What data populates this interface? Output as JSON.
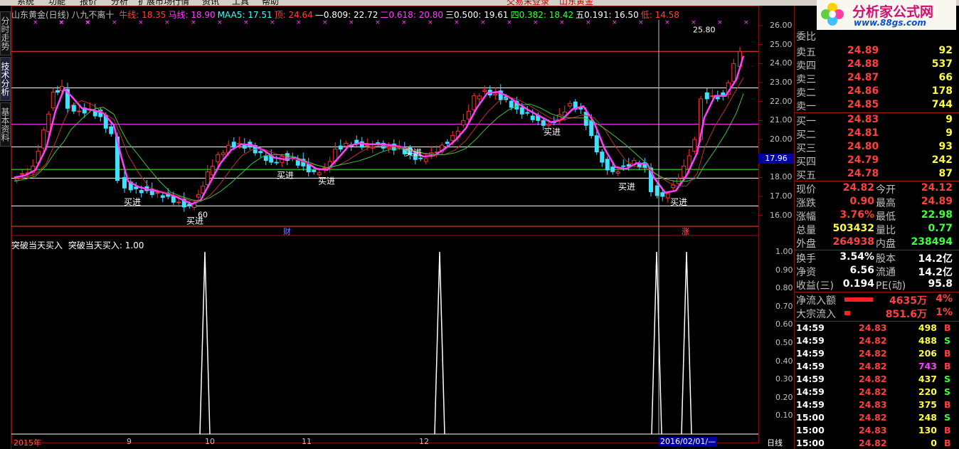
{
  "menu": [
    "系统",
    "功能",
    "报价",
    "分析",
    "扩展市场行情",
    "资讯",
    "工具",
    "帮助"
  ],
  "menu_right": [
    "交易未登录",
    "山东黄金"
  ],
  "side_tabs": [
    "分时走势",
    "技术分析",
    "基本资料"
  ],
  "header": {
    "stock": "山东黄金(日线)",
    "indicator": "八九不离十",
    "items": [
      {
        "label": "牛线: 18.35",
        "color": "#ff4040"
      },
      {
        "label": "马线: 18.90",
        "color": "#ff40ff"
      },
      {
        "label": "MAA5: 17.51",
        "color": "#40ffff"
      },
      {
        "label": "顶: 24.64",
        "color": "#ff4040"
      },
      {
        "label": "—0.809: 22.72",
        "color": "#ffffff"
      },
      {
        "label": "二0.618: 20.80",
        "color": "#ff40ff"
      },
      {
        "label": "三0.500: 19.61",
        "color": "#ffffff"
      },
      {
        "label": "四0.382: 18.42",
        "color": "#40ff40"
      },
      {
        "label": "五0.191: 16.50",
        "color": "#ffffff"
      },
      {
        "label": "低: 14.58",
        "color": "#ff4040"
      }
    ]
  },
  "price_axis": [
    "26.00",
    "25.00",
    "24.00",
    "23.00",
    "22.00",
    "21.00",
    "20.00",
    "19.00",
    "18.00",
    "17.00",
    "16.00"
  ],
  "current_price_tag": "17.96",
  "annotations": {
    "peak": "25.80",
    "low": "60",
    "buy": "买进",
    "fin": "财",
    "rise": "涨"
  },
  "sub_indicator": {
    "title": "突破当天买入",
    "value_label": "突破当天买入: 1.00"
  },
  "sub_axis": [
    "1.00",
    "0.90",
    "0.80",
    "0.70",
    "0.60",
    "0.50",
    "0.40",
    "0.30",
    "0.20",
    "0.10"
  ],
  "date_axis": [
    "2015年",
    "9",
    "10",
    "11",
    "12",
    "2016/02/01/—"
  ],
  "period_label": "日线",
  "logo": {
    "title": "分析家公式网",
    "url": "www.88gs.com"
  },
  "order_book": {
    "ratio_label": "委比",
    "asks": [
      {
        "label": "卖五",
        "price": "24.89",
        "vol": "92"
      },
      {
        "label": "卖四",
        "price": "24.88",
        "vol": "537"
      },
      {
        "label": "卖三",
        "price": "24.87",
        "vol": "66"
      },
      {
        "label": "卖二",
        "price": "24.86",
        "vol": "178"
      },
      {
        "label": "卖一",
        "price": "24.85",
        "vol": "744"
      }
    ],
    "bids": [
      {
        "label": "买一",
        "price": "24.83",
        "vol": "9"
      },
      {
        "label": "买二",
        "price": "24.81",
        "vol": "9"
      },
      {
        "label": "买三",
        "price": "24.80",
        "vol": "93"
      },
      {
        "label": "买四",
        "price": "24.79",
        "vol": "242"
      },
      {
        "label": "买五",
        "price": "24.78",
        "vol": "87"
      }
    ]
  },
  "quote": [
    {
      "l1": "现价",
      "v1": "24.82",
      "c1": "#ff4040",
      "l2": "今开",
      "v2": "24.12",
      "c2": "#ff4040"
    },
    {
      "l1": "涨跌",
      "v1": "0.90",
      "c1": "#ff4040",
      "l2": "最高",
      "v2": "24.89",
      "c2": "#ff4040"
    },
    {
      "l1": "涨幅",
      "v1": "3.76%",
      "c1": "#ff4040",
      "l2": "最低",
      "v2": "22.98",
      "c2": "#40ff40"
    },
    {
      "l1": "总量",
      "v1": "503432",
      "c1": "#ffff40",
      "l2": "量比",
      "v2": "0.77",
      "c2": "#40ff40"
    },
    {
      "l1": "外盘",
      "v1": "264938",
      "c1": "#ff4040",
      "l2": "内盘",
      "v2": "238494",
      "c2": "#40ff40"
    }
  ],
  "fundamentals": [
    {
      "l1": "换手",
      "v1": "3.54%",
      "l2": "股本",
      "v2": "14.2亿"
    },
    {
      "l1": "净资",
      "v1": "6.56",
      "l2": "流通",
      "v2": "14.2亿"
    },
    {
      "l1": "收益(三)",
      "v1": "0.194",
      "l2": "PE(动)",
      "v2": "95.8"
    }
  ],
  "flows": [
    {
      "label": "净流入额",
      "value": "4635万",
      "pct": "4%",
      "fill": 0.8
    },
    {
      "label": "大宗流入",
      "value": "851.6万",
      "pct": "1%",
      "fill": 0.15
    }
  ],
  "ticks": [
    {
      "time": "14:59",
      "price": "24.83",
      "vol": "498",
      "side": "B",
      "vc": "#ffff40"
    },
    {
      "time": "14:59",
      "price": "24.82",
      "vol": "488",
      "side": "S",
      "vc": "#ffff40"
    },
    {
      "time": "14:59",
      "price": "24.82",
      "vol": "206",
      "side": "B",
      "vc": "#ffff40"
    },
    {
      "time": "14:59",
      "price": "24.82",
      "vol": "743",
      "side": "B",
      "vc": "#ff40ff"
    },
    {
      "time": "14:59",
      "price": "24.82",
      "vol": "437",
      "side": "S",
      "vc": "#ffff40"
    },
    {
      "time": "14:59",
      "price": "24.82",
      "vol": "220",
      "side": "S",
      "vc": "#ffff40"
    },
    {
      "time": "14:59",
      "price": "24.83",
      "vol": "375",
      "side": "B",
      "vc": "#ffff40"
    },
    {
      "time": "15:00",
      "price": "24.82",
      "vol": "248",
      "side": "S",
      "vc": "#ffff40"
    },
    {
      "time": "15:00",
      "price": "24.83",
      "vol": "130",
      "side": "B",
      "vc": "#ffff40"
    },
    {
      "time": "15:00",
      "price": "24.82",
      "vol": "0",
      "side": "B",
      "vc": "#ffff40"
    }
  ]
}
